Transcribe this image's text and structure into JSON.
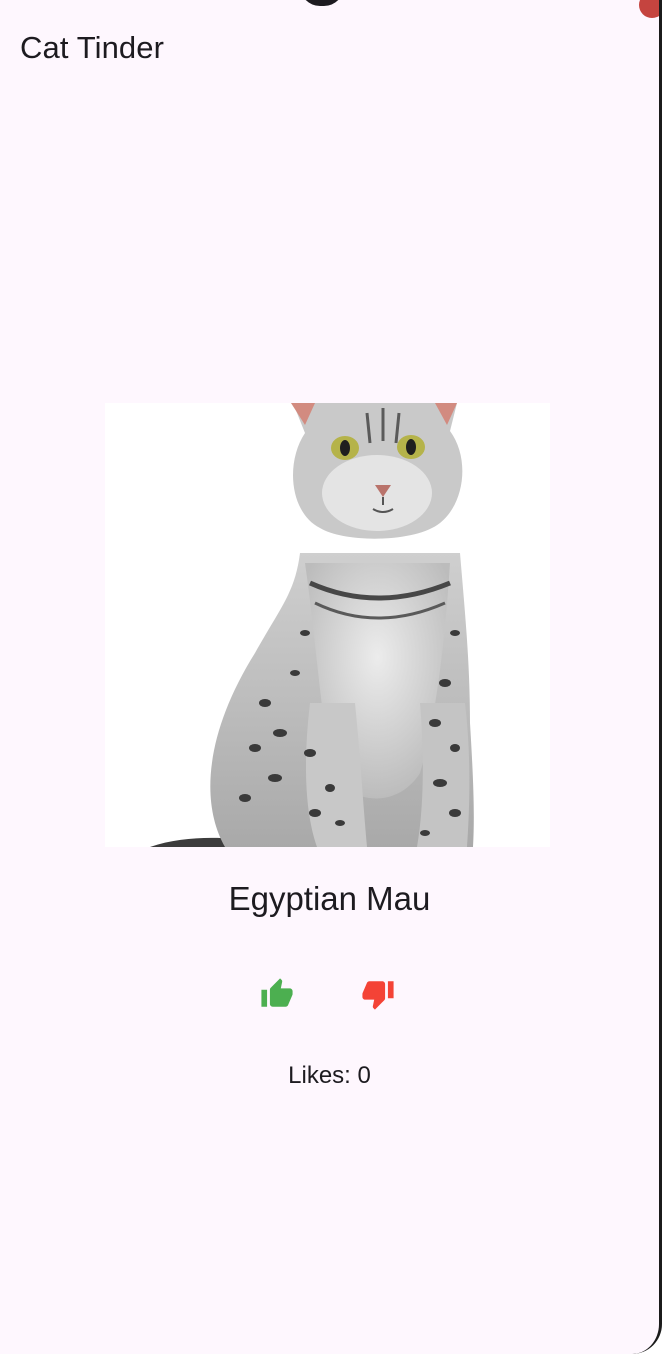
{
  "app": {
    "title": "Cat Tinder"
  },
  "cat": {
    "breed": "Egyptian Mau",
    "image_subject": "silver spotted cat sitting"
  },
  "actions": {
    "like_icon": "thumb-up-icon",
    "dislike_icon": "thumb-down-icon",
    "like_color": "#4caf50",
    "dislike_color": "#f44336"
  },
  "stats": {
    "likes_label": "Likes: 0"
  },
  "theme": {
    "background": "#fef7fe",
    "text": "#1d1b20"
  }
}
